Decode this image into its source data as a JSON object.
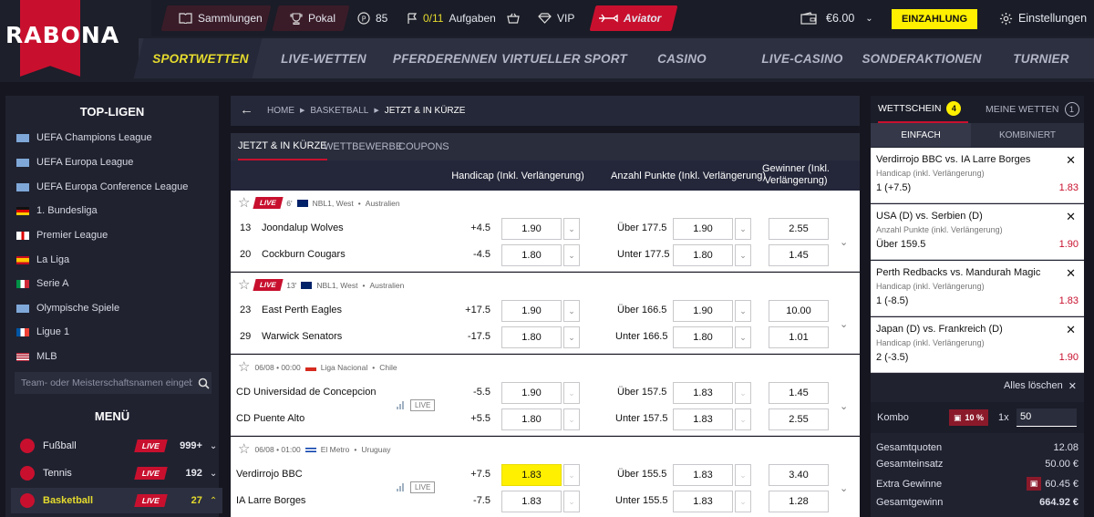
{
  "logo": {
    "text": "RABONA"
  },
  "topbar": {
    "collections": "Sammlungen",
    "cup": "Pokal",
    "points": "85",
    "missions_progress": "0/11",
    "missions_label": "Aufgaben",
    "vip": "VIP",
    "aviator": "Aviator",
    "balance": "€6.00",
    "deposit": "EINZAHLUNG",
    "settings": "Einstellungen"
  },
  "nav": [
    "SPORTWETTEN",
    "LIVE-WETTEN",
    "PFERDERENNEN",
    "VIRTUELLER SPORT",
    "CASINO",
    "LIVE-CASINO",
    "SONDERAKTIONEN",
    "TURNIER"
  ],
  "left": {
    "top_title": "TOP-LIGEN",
    "leagues": [
      {
        "name": "UEFA Champions League",
        "flag": "eu"
      },
      {
        "name": "UEFA Europa League",
        "flag": "eu"
      },
      {
        "name": "UEFA Europa Conference League",
        "flag": "eu"
      },
      {
        "name": "1. Bundesliga",
        "flag": "de"
      },
      {
        "name": "Premier League",
        "flag": "en"
      },
      {
        "name": "La Liga",
        "flag": "es"
      },
      {
        "name": "Serie A",
        "flag": "it"
      },
      {
        "name": "Olympische Spiele",
        "flag": "eu"
      },
      {
        "name": "Ligue 1",
        "flag": "fr"
      },
      {
        "name": "MLB",
        "flag": "us"
      }
    ],
    "search_placeholder": "Team- oder Meisterschaftsnamen eingeben",
    "menu_title": "MENÜ",
    "menu": [
      {
        "name": "Fußball",
        "live": "LIVE",
        "count": "999+"
      },
      {
        "name": "Tennis",
        "live": "LIVE",
        "count": "192"
      },
      {
        "name": "Basketball",
        "live": "LIVE",
        "count": "27"
      }
    ]
  },
  "main": {
    "breadcrumb": [
      "HOME",
      "BASKETBALL",
      "JETZT & IN KÜRZE"
    ],
    "tabs": [
      "JETZT & IN KÜRZE",
      "WETTBEWERBE",
      "COUPONS"
    ],
    "columns": {
      "handicap": "Handicap (Inkl. Verlängerung)",
      "total": "Anzahl Punkte (Inkl. Verlängerung)",
      "winner": "Gewinner (Inkl. Verlängerung)"
    },
    "events": [
      {
        "live": "LIVE",
        "time": "6'",
        "league": "NBL1, West",
        "country": "Australien",
        "rows": [
          {
            "num": "13",
            "team": "Joondalup Wolves",
            "hcp": "+4.5",
            "hcp_odd": "1.90",
            "tot_label": "Über 177.5",
            "tot_odd": "1.90",
            "win": "2.55"
          },
          {
            "num": "20",
            "team": "Cockburn Cougars",
            "hcp": "-4.5",
            "hcp_odd": "1.80",
            "tot_label": "Unter 177.5",
            "tot_odd": "1.80",
            "win": "1.45"
          }
        ]
      },
      {
        "live": "LIVE",
        "time": "13'",
        "league": "NBL1, West",
        "country": "Australien",
        "rows": [
          {
            "num": "23",
            "team": "East Perth Eagles",
            "hcp": "+17.5",
            "hcp_odd": "1.90",
            "tot_label": "Über 166.5",
            "tot_odd": "1.90",
            "win": "10.00"
          },
          {
            "num": "29",
            "team": "Warwick Senators",
            "hcp": "-17.5",
            "hcp_odd": "1.80",
            "tot_label": "Unter 166.5",
            "tot_odd": "1.80",
            "win": "1.01"
          }
        ]
      },
      {
        "live": "",
        "time": "06/08 • 00:00",
        "league": "Liga Nacional",
        "country": "Chile",
        "stream": "LIVE",
        "rows": [
          {
            "num": "",
            "team": "CD Universidad de Concepcion",
            "hcp": "-5.5",
            "hcp_odd": "1.90",
            "tot_label": "Über 157.5",
            "tot_odd": "1.83",
            "win": "1.45"
          },
          {
            "num": "",
            "team": "CD Puente Alto",
            "hcp": "+5.5",
            "hcp_odd": "1.80",
            "tot_label": "Unter 157.5",
            "tot_odd": "1.83",
            "win": "2.55"
          }
        ]
      },
      {
        "live": "",
        "time": "06/08 • 01:00",
        "league": "El Metro",
        "country": "Uruguay",
        "stream": "LIVE",
        "rows": [
          {
            "num": "",
            "team": "Verdirrojo BBC",
            "hcp": "+7.5",
            "hcp_odd": "1.83",
            "tot_label": "Über 155.5",
            "tot_odd": "1.83",
            "win": "3.40"
          },
          {
            "num": "",
            "team": "IA Larre Borges",
            "hcp": "-7.5",
            "hcp_odd": "1.83",
            "tot_label": "Unter 155.5",
            "tot_odd": "1.83",
            "win": "1.28"
          }
        ]
      }
    ]
  },
  "slip": {
    "tab_slip": "WETTSCHEIN",
    "slip_count": "4",
    "tab_bets": "MEINE WETTEN",
    "bets_count": "1",
    "single": "EINFACH",
    "combo": "KOMBINIERT",
    "items": [
      {
        "title": "Verdirrojo BBC vs. IA Larre Borges",
        "market": "Handicap (inkl. Verlängerung)",
        "pick": "1 (+7.5)",
        "odd": "1.83"
      },
      {
        "title": "USA (D) vs. Serbien (D)",
        "market": "Anzahl Punkte (inkl. Verlängerung)",
        "pick": "Über 159.5",
        "odd": "1.90"
      },
      {
        "title": "Perth Redbacks vs. Mandurah Magic",
        "market": "Handicap (inkl. Verlängerung)",
        "pick": "1 (-8.5)",
        "odd": "1.83"
      },
      {
        "title": "Japan (D) vs. Frankreich (D)",
        "market": "Handicap (inkl. Verlängerung)",
        "pick": "2 (-3.5)",
        "odd": "1.90"
      }
    ],
    "clear_all": "Alles löschen",
    "kombo_label": "Kombo",
    "boost": "10 %",
    "multiplier": "1x",
    "stake": "50",
    "totals": [
      {
        "label": "Gesamtquoten",
        "value": "12.08"
      },
      {
        "label": "Gesamteinsatz",
        "value": "50.00 €"
      },
      {
        "label": "Extra Gewinne",
        "value": "60.45 €"
      },
      {
        "label": "Gesamtgewinn",
        "value": "664.92 €"
      }
    ]
  }
}
